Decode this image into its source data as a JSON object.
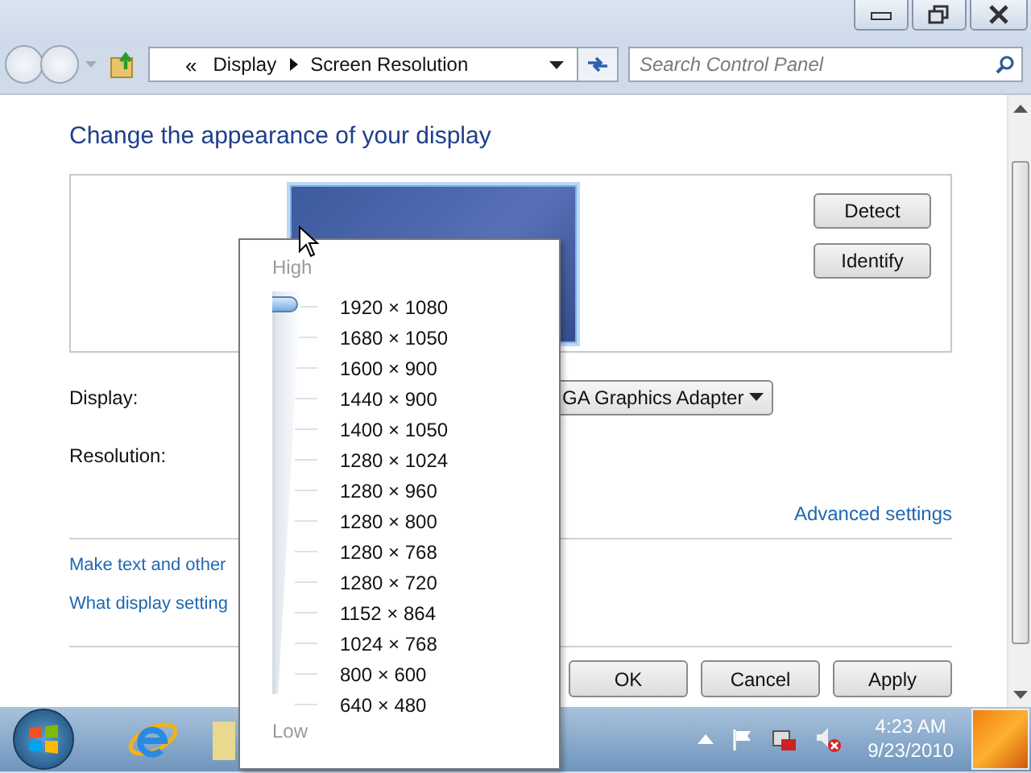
{
  "address_bar": {
    "breadcrumb": [
      "Display",
      "Screen Resolution"
    ],
    "overflow": "«"
  },
  "search": {
    "placeholder": "Search Control Panel"
  },
  "heading": "Change the appearance of your display",
  "preview_buttons": [
    "Detect",
    "Identify"
  ],
  "fields": [
    {
      "label": "Display:",
      "value": "GA Graphics Adapter"
    },
    {
      "label": "Resolution:"
    }
  ],
  "advanced_link": "Advanced settings",
  "links": [
    "Make text and other",
    "What display setting"
  ],
  "dialog_buttons": [
    "OK",
    "Cancel",
    "Apply"
  ],
  "resolution_popup": {
    "high_label": "High",
    "low_label": "Low",
    "level": 1,
    "options": [
      "1920 × 1080",
      "1680 × 1050",
      "1600 × 900",
      "1440 × 900",
      "1400 × 1050",
      "1280 × 1024",
      "1280 × 960",
      "1280 × 800",
      "1280 × 768",
      "1280 × 720",
      "1152 × 864",
      "1024 × 768",
      "800 × 600",
      "640 × 480"
    ]
  },
  "taskbar": {
    "time": "4:23 AM",
    "date": "9/23/2010",
    "volume_muted": true
  }
}
